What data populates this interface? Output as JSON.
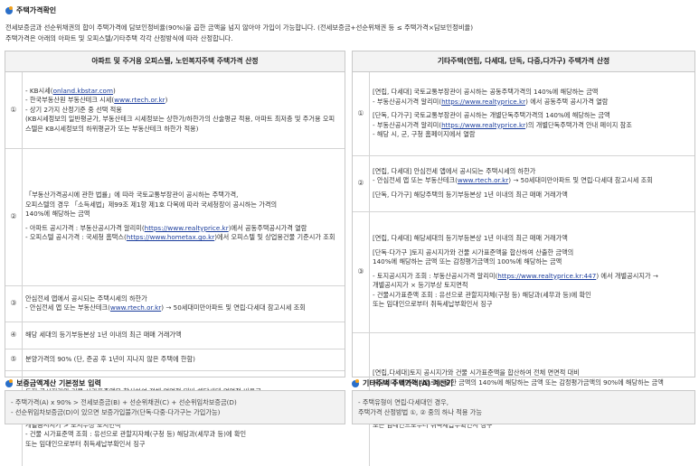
{
  "header": {
    "title": "주택가격확인"
  },
  "intro": {
    "line1": "전세보증금과 선순위채권의 합이 주택가격에 담보인정비율(90%)을 곱한 금액을 넘지 않아야 가입이 가능합니다. (전세보증금+선순위채권 등 ≤ 주택가격×담보인정비율)",
    "line2": "주택가격은 아래의 아파트 및 오피스텔/기타주택 각각 산정방식에 따라 산정합니다."
  },
  "left_panel": {
    "title": "아파트 및 주거용 오피스텔, 노인복지주택 주택가격 산정",
    "rows": [
      {
        "num": "①",
        "lines": [
          {
            "pre": "- KB시세(",
            "link": "onland.kbstar.com",
            "post": ")"
          },
          {
            "pre": "- 한국부동산원 부동산테크 시세(",
            "link": "www.rtech.or.kr",
            "post": ")"
          },
          {
            "pre": "- 상기 2가지 산정기준 중 선택 적용",
            "link": "",
            "post": ""
          },
          {
            "pre": "  (KB시세정보의 일반평균가, 부동산테크 시세정보는 상한가/하한가의 산술평균 적용, 아파트 최저층 및 주거용 오피",
            "link": "",
            "post": ""
          },
          {
            "pre": "  스텔은 KB시세정보의 하위평균가 또는 부동산테크 하한가 적용)",
            "link": "",
            "post": ""
          }
        ]
      },
      {
        "num": "②",
        "lines": [
          {
            "pre": "「부동산가격공시에 관한 법률」에 따라 국토교통부장관이 공시하는 주택가격,",
            "link": "",
            "post": ""
          },
          {
            "pre": "오피스텔의 경우 「소득세법」제99조 제1항 제1호 다목에 따라 국세청장이 공시하는 가격의",
            "link": "",
            "post": ""
          },
          {
            "pre": "140%에 해당하는 금액",
            "link": "",
            "post": ""
          },
          {
            "pre": "",
            "link": "",
            "post": "",
            "gap": true
          },
          {
            "pre": "- 아파트 공시가격 : 부동산공시가격 알리미(",
            "link": "https://www.realtyprice.kr",
            "post": ")에서 공동주택공시가격 열람"
          },
          {
            "pre": "- 오피스텔 공시가격 : 국세청 홈택스(",
            "link": "https://www.hometax.go.kr",
            "post": ")에서 오피스텔 및 상업용건물 기준시가 조회"
          }
        ]
      },
      {
        "num": "③",
        "lines": [
          {
            "pre": "안심전세 앱에서 공시되는 주택시세의 하한가",
            "link": "",
            "post": ""
          },
          {
            "pre": "- 안심전세 앱 또는 부동산테크(",
            "link": "www.rtech.or.kr",
            "post": ") → 50세대미만아파트 및 연립·다세대 참고시세 조회"
          }
        ]
      },
      {
        "num": "④",
        "lines": [
          {
            "pre": "해당 세대의 등기부등본상 1년 이내의 최근 매매 거래가액",
            "link": "",
            "post": ""
          }
        ]
      },
      {
        "num": "⑤",
        "lines": [
          {
            "pre": "분양가격의 90% (단, 준공 후 1년이 지나지 않은 주택에 한함)",
            "link": "",
            "post": ""
          }
        ]
      },
      {
        "num": "⑥",
        "lines": [
          {
            "pre": "토지 공시지가와 건물 시가표준액을 합산하여 전체 면면적 대비 해당세대 면면적 비율로",
            "link": "",
            "post": ""
          },
          {
            "pre": "산출한 금액의 140%에 해당하는 금액 또는 감정평가금액의 100%에 해당하는 금액",
            "link": "",
            "post": ""
          },
          {
            "pre": "",
            "link": "",
            "post": "",
            "gap": true
          },
          {
            "pre": "- 토지공시지가 조회 : 부동산공시가격 알리미(",
            "link": "https://www.realtyprice.kr:447",
            "post": ")에서 개별공시지가 →"
          },
          {
            "pre": "  개별공시지가 > 토지부상 토지면적",
            "link": "",
            "post": ""
          },
          {
            "pre": "- 건물 시가표준액 조회 : 유선으로 관할지자체(구청 등) 해당과(세무과 등)에 확인",
            "link": "",
            "post": ""
          },
          {
            "pre": "  또는 임대인으로부터 취득세납부확인서 징구",
            "link": "",
            "post": ""
          }
        ]
      }
    ]
  },
  "right_panel": {
    "title": "기타주택(연립, 다세대, 단독, 다중,다가구) 주택가격 산정",
    "rows": [
      {
        "num": "①",
        "lines": [
          {
            "pre": "[연립, 다세대] 국토교통부장관이 공시하는 공동주택가격의 140%에 해당하는 금액",
            "link": "",
            "post": ""
          },
          {
            "pre": "- 부동산공시가격 알리미(",
            "link": "https://www.realtyprice.kr",
            "post": ") 에서 공동주택 공시가격 열람"
          },
          {
            "pre": "",
            "link": "",
            "post": "",
            "gap": true
          },
          {
            "pre": "[단독, 다가구] 국토교통부장관이 공시하는 개별단독주택가격의 140%에 해당하는 금액",
            "link": "",
            "post": ""
          },
          {
            "pre": "- 부동산공시가격 알리미(",
            "link": "https://www.realtyprice.kr",
            "post": ")의 개별단독주택가격 안내 페이지 참조"
          },
          {
            "pre": "- 해당 시, 군, 구청 홈페이지에서 열람",
            "link": "",
            "post": ""
          }
        ]
      },
      {
        "num": "②",
        "lines": [
          {
            "pre": "[연립, 다세대] 안심전세 앱에서 공시되는 주택시세의 하한가",
            "link": "",
            "post": ""
          },
          {
            "pre": "- 안심전세 앱 또는 부동산테크(",
            "link": "www.rtech.or.kr",
            "post": ") → 50세대미만아파트 및 연립·다세대 참고시세 조회"
          },
          {
            "pre": "",
            "link": "",
            "post": "",
            "gap": true
          },
          {
            "pre": "[단독, 다가구] 해당주택의 등기부등본상 1년 이내의 최근 매매 거래가액",
            "link": "",
            "post": ""
          }
        ]
      },
      {
        "num": "③",
        "lines": [
          {
            "pre": "[연립, 다세대] 해당세대의 등기부등본상 1년 이내의 최근 매매 거래가액",
            "link": "",
            "post": ""
          },
          {
            "pre": "",
            "link": "",
            "post": "",
            "gap": true
          },
          {
            "pre": "[단독·다가구 ]토지 공시지가와 건물 시가표준액을 합산하여 산출한 금액의",
            "link": "",
            "post": ""
          },
          {
            "pre": "140%에 해당하는 금액 또는 감정평가금액의 100%에 해당하는 금액",
            "link": "",
            "post": ""
          },
          {
            "pre": "",
            "link": "",
            "post": "",
            "gap": true
          },
          {
            "pre": "- 토지공시지가 조회 : 부동산공시가격 알리미(",
            "link": "https://www.realtyprice.kr:447",
            "post": ") 에서 개별공시지가 →"
          },
          {
            "pre": "  개별공시지가 × 등기부상 토지면적",
            "link": "",
            "post": ""
          },
          {
            "pre": "- 건물시가표준액 조회 : 유선으로 관할지자체(구청 등) 해당과(세무과 등)에 확인",
            "link": "",
            "post": ""
          },
          {
            "pre": "  또는 임대인으로부터 취득세납부확인서 징구",
            "link": "",
            "post": ""
          }
        ]
      },
      {
        "num": "④",
        "lines": [
          {
            "pre": "[연립,다세대]토지 공시지가와 건물 시가표준액을 합산하여 전체 면면적 대비",
            "link": "",
            "post": ""
          },
          {
            "pre": "해당세대 면면적 비율로 산출한 금액의 140%에 해당하는 금액 또는 감정평가금액의 90%에 해당하는 금액",
            "link": "",
            "post": ""
          },
          {
            "pre": "",
            "link": "",
            "post": "",
            "gap": true
          },
          {
            "pre": "- 토지공시지가 조회 : 부동산공시가격 알리미(",
            "link": "https://www.realtyprice.kr:447",
            "post": ") 에서 개별공시지가 →"
          },
          {
            "pre": "  개별공시지가 × 등기부상 토지면적",
            "link": "",
            "post": ""
          },
          {
            "pre": "- 건물시가표준액 조회 : 유선으로 관할지자체(구청 등) 해당과(세무과 등)에 확인",
            "link": "",
            "post": ""
          },
          {
            "pre": "  또는 임대인으로부터 취득세납부확인서 징구",
            "link": "",
            "post": ""
          }
        ]
      }
    ]
  },
  "bottom_left": {
    "title": "보증금액계산 기본정보 입력",
    "lines": [
      "- 주택가격(A) x 90% > 전세보증금(B) + 선순위채권(C) + 선순위임차보증금(D)",
      "- 선순위임차보증금(D)이 있으면 보증가입불가(단독·다중·다가구는 가입가능)"
    ]
  },
  "bottom_right": {
    "title": "기타주택 주택가격(A) 계산기",
    "lines": [
      "- 주택유형이 연립·다세대인 경우,",
      "  주택가격 산정방법 ①, ② 중의 하나 적용 가능"
    ]
  }
}
